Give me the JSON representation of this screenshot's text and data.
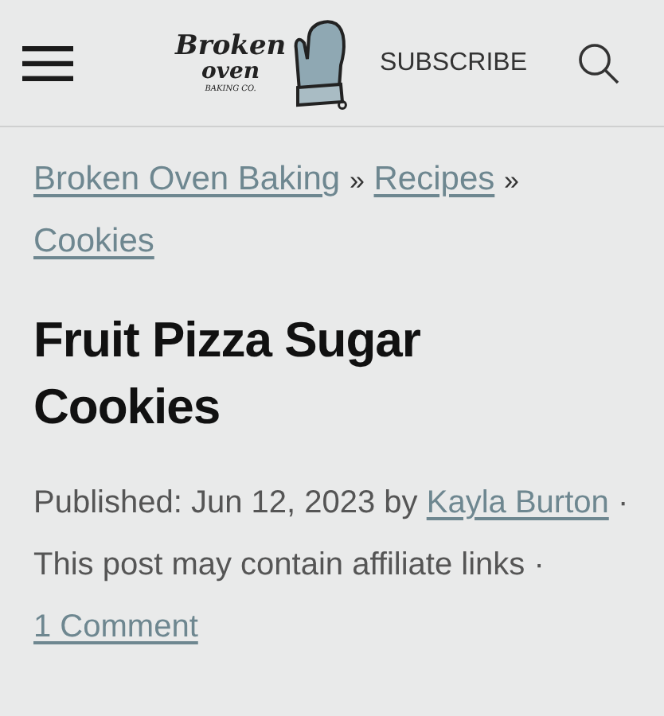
{
  "header": {
    "logo": {
      "line_1": "Broken",
      "line_2": "oven",
      "line_3": "BAKING CO."
    },
    "subscribe": "SUBSCRIBE"
  },
  "breadcrumb": [
    {
      "kind": "link",
      "text": "Broken Oven Baking"
    },
    {
      "kind": "separator",
      "text": "»"
    },
    {
      "kind": "link",
      "text": "Recipes"
    },
    {
      "kind": "separator",
      "text": "»"
    },
    {
      "kind": "link",
      "text": "Cookies"
    }
  ],
  "title": "Fruit Pizza Sugar Cookies",
  "meta": [
    {
      "kind": "text",
      "text": "Published: Jun 12, 2023 by"
    },
    {
      "kind": "link",
      "text": "Kayla Burton"
    },
    {
      "kind": "text",
      "text": "· This post may contain affiliate links ·"
    },
    {
      "kind": "link",
      "text": "1 Comment"
    }
  ]
}
